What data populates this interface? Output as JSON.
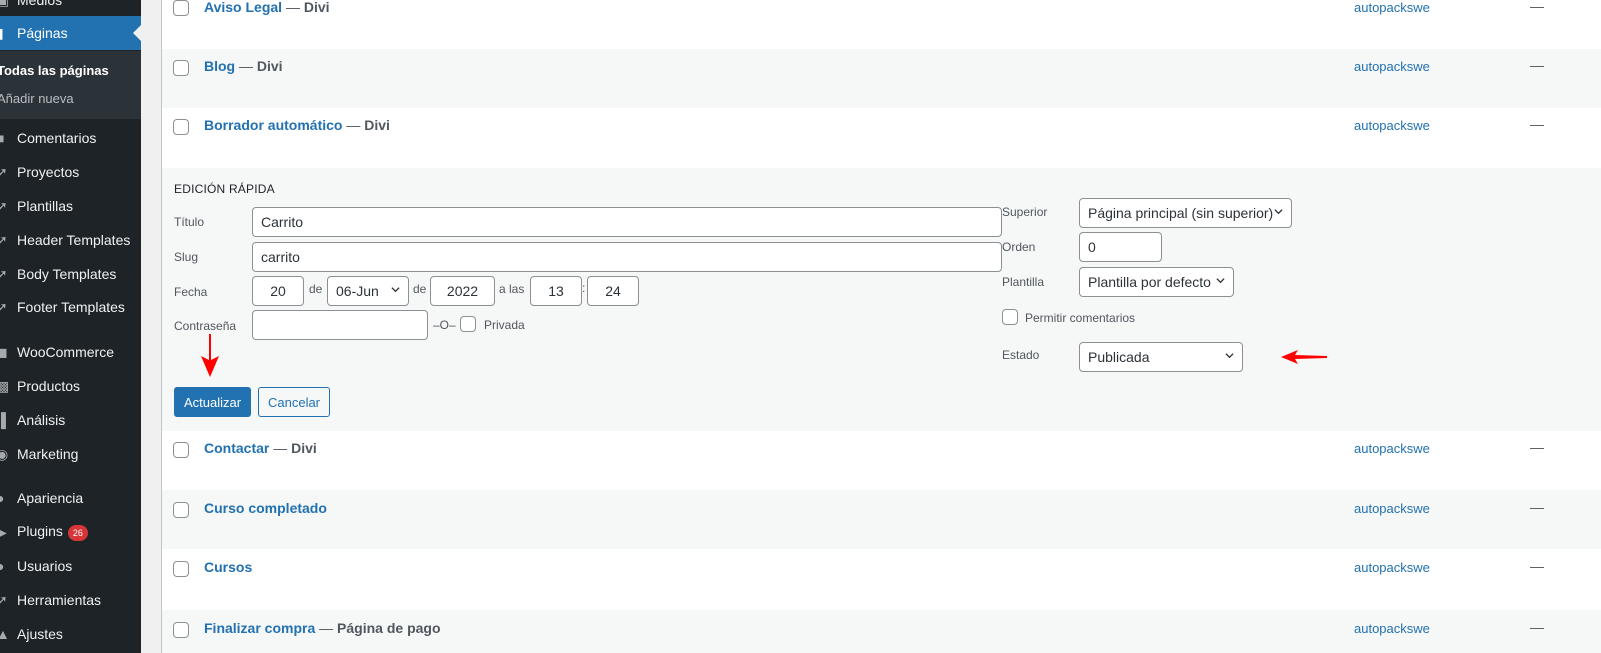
{
  "sidebar": {
    "items_top": [
      {
        "label": "Medios",
        "icon": "media-icon"
      },
      {
        "label": "Páginas",
        "icon": "page-icon",
        "current": true
      }
    ],
    "submenu": [
      {
        "label": "Todas las páginas",
        "active": true
      },
      {
        "label": "Añadir nueva",
        "active": false
      }
    ],
    "items": [
      {
        "label": "Comentarios",
        "icon": "comments-icon"
      },
      {
        "label": "Proyectos",
        "icon": "pin-icon"
      },
      {
        "label": "Plantillas",
        "icon": "pin-icon"
      },
      {
        "label": "Header Templates",
        "icon": "pin-icon"
      },
      {
        "label": "Body Templates",
        "icon": "pin-icon"
      },
      {
        "label": "Footer Templates",
        "icon": "pin-icon"
      },
      {
        "label": "WooCommerce",
        "icon": "woocommerce-icon"
      },
      {
        "label": "Productos",
        "icon": "products-icon"
      },
      {
        "label": "Análisis",
        "icon": "analytics-icon"
      },
      {
        "label": "Marketing",
        "icon": "marketing-icon"
      },
      {
        "label": "Apariencia",
        "icon": "appearance-icon"
      },
      {
        "label": "Plugins",
        "icon": "plugins-icon",
        "badge": "26"
      },
      {
        "label": "Usuarios",
        "icon": "users-icon"
      },
      {
        "label": "Herramientas",
        "icon": "tools-icon"
      },
      {
        "label": "Ajustes",
        "icon": "settings-icon"
      }
    ]
  },
  "rows_top": [
    {
      "title": "Aviso Legal",
      "sep": " — ",
      "state": "Divi",
      "author": "autopackswe",
      "date": "—"
    },
    {
      "title": "Blog",
      "sep": " — ",
      "state": "Divi",
      "author": "autopackswe",
      "date": "—"
    },
    {
      "title": "Borrador automático",
      "sep": " — ",
      "state": "Divi",
      "author": "autopackswe",
      "date": "—"
    }
  ],
  "quick_edit": {
    "heading": "Edición rápida",
    "title_label": "Título",
    "title_value": "Carrito",
    "slug_label": "Slug",
    "slug_value": "carrito",
    "date_label": "Fecha",
    "day": "20",
    "de1": "de",
    "month": "06-Jun",
    "de2": "de",
    "year": "2022",
    "at": "a las",
    "hour": "13",
    "colon": ":",
    "minute": "24",
    "password_label": "Contraseña",
    "password_value": "",
    "or": "–O–",
    "private_label": "Privada",
    "parent_label": "Superior",
    "parent_value": "Página principal (sin superior)",
    "order_label": "Orden",
    "order_value": "0",
    "template_label": "Plantilla",
    "template_value": "Plantilla por defecto",
    "comments_label": "Permitir comentarios",
    "status_label": "Estado",
    "status_value": "Publicada",
    "update_button": "Actualizar",
    "cancel_button": "Cancelar"
  },
  "rows_bottom": [
    {
      "title": "Contactar",
      "sep": " — ",
      "state": "Divi",
      "author": "autopackswe",
      "date": "—"
    },
    {
      "title": "Curso completado",
      "sep": "",
      "state": "",
      "author": "autopackswe",
      "date": "—"
    },
    {
      "title": "Cursos",
      "sep": "",
      "state": "",
      "author": "autopackswe",
      "date": "—"
    },
    {
      "title": "Finalizar compra",
      "sep": " — ",
      "state": "Página de pago",
      "author": "autopackswe",
      "date": "—"
    }
  ],
  "colors": {
    "admin_bar": "#1d2327",
    "accent": "#2271b1",
    "annotation_arrow": "#ff0000",
    "badge": "#d63638"
  }
}
